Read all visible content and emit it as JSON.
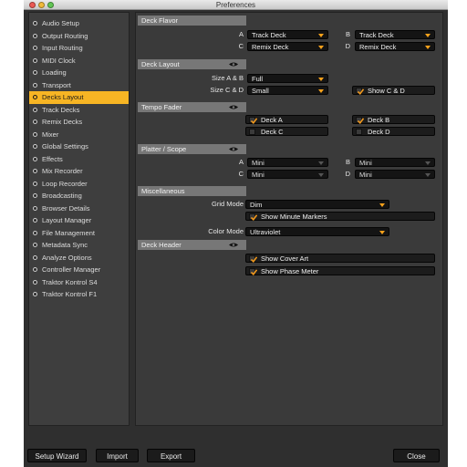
{
  "window": {
    "title": "Preferences"
  },
  "sidebar": {
    "items": [
      {
        "label": "Audio Setup",
        "active": false
      },
      {
        "label": "Output Routing",
        "active": false
      },
      {
        "label": "Input Routing",
        "active": false
      },
      {
        "label": "MIDI Clock",
        "active": false
      },
      {
        "label": "Loading",
        "active": false
      },
      {
        "label": "Transport",
        "active": false
      },
      {
        "label": "Decks Layout",
        "active": true
      },
      {
        "label": "Track Decks",
        "active": false
      },
      {
        "label": "Remix Decks",
        "active": false
      },
      {
        "label": "Mixer",
        "active": false
      },
      {
        "label": "Global Settings",
        "active": false
      },
      {
        "label": "Effects",
        "active": false
      },
      {
        "label": "Mix Recorder",
        "active": false
      },
      {
        "label": "Loop Recorder",
        "active": false
      },
      {
        "label": "Broadcasting",
        "active": false
      },
      {
        "label": "Browser Details",
        "active": false
      },
      {
        "label": "Layout Manager",
        "active": false
      },
      {
        "label": "File Management",
        "active": false
      },
      {
        "label": "Metadata Sync",
        "active": false
      },
      {
        "label": "Analyze Options",
        "active": false
      },
      {
        "label": "Controller Manager",
        "active": false
      },
      {
        "label": "Traktor Kontrol S4",
        "active": false
      },
      {
        "label": "Traktor Kontrol F1",
        "active": false
      }
    ]
  },
  "deck_flavor": {
    "title": "Deck Flavor",
    "deck_a": {
      "label": "A",
      "value": "Track Deck"
    },
    "deck_b": {
      "label": "B",
      "value": "Track Deck"
    },
    "deck_c": {
      "label": "C",
      "value": "Remix Deck"
    },
    "deck_d": {
      "label": "D",
      "value": "Remix Deck"
    }
  },
  "deck_layout": {
    "title": "Deck Layout",
    "size_ab": {
      "label": "Size A & B",
      "value": "Full"
    },
    "size_cd": {
      "label": "Size C & D",
      "value": "Small"
    },
    "show_cd": {
      "label": "Show C & D",
      "checked": true
    }
  },
  "tempo_fader": {
    "title": "Tempo Fader",
    "deck_a": {
      "label": "Deck A",
      "checked": true
    },
    "deck_b": {
      "label": "Deck B",
      "checked": true
    },
    "deck_c": {
      "label": "Deck C",
      "checked": false
    },
    "deck_d": {
      "label": "Deck D",
      "checked": false
    }
  },
  "platter_scope": {
    "title": "Platter / Scope",
    "deck_a": {
      "label": "A",
      "value": "Mini"
    },
    "deck_b": {
      "label": "B",
      "value": "Mini"
    },
    "deck_c": {
      "label": "C",
      "value": "Mini"
    },
    "deck_d": {
      "label": "D",
      "value": "Mini"
    }
  },
  "miscellaneous": {
    "title": "Miscellaneous",
    "grid_mode": {
      "label": "Grid Mode",
      "value": "Dim"
    },
    "show_minute_markers": {
      "label": "Show Minute Markers",
      "checked": true
    },
    "color_mode": {
      "label": "Color Mode",
      "value": "Ultraviolet"
    }
  },
  "deck_header": {
    "title": "Deck Header",
    "show_cover_art": {
      "label": "Show Cover Art",
      "checked": true
    },
    "show_phase_meter": {
      "label": "Show Phase Meter",
      "checked": true
    }
  },
  "footer": {
    "setup_wizard": "Setup Wizard",
    "import": "Import",
    "export": "Export",
    "close": "Close"
  },
  "colors": {
    "accent": "#f7b524",
    "dropdown_arrow": "#f7a21b",
    "check": "#f39a1e",
    "panel_bg": "#3a3a3a",
    "section_header_bg": "#777777"
  },
  "icons": {
    "eye": "eye-icon",
    "checkmark": "check-icon",
    "bullet": "radio-bullet-icon",
    "dropdown": "dropdown-arrow-icon"
  }
}
